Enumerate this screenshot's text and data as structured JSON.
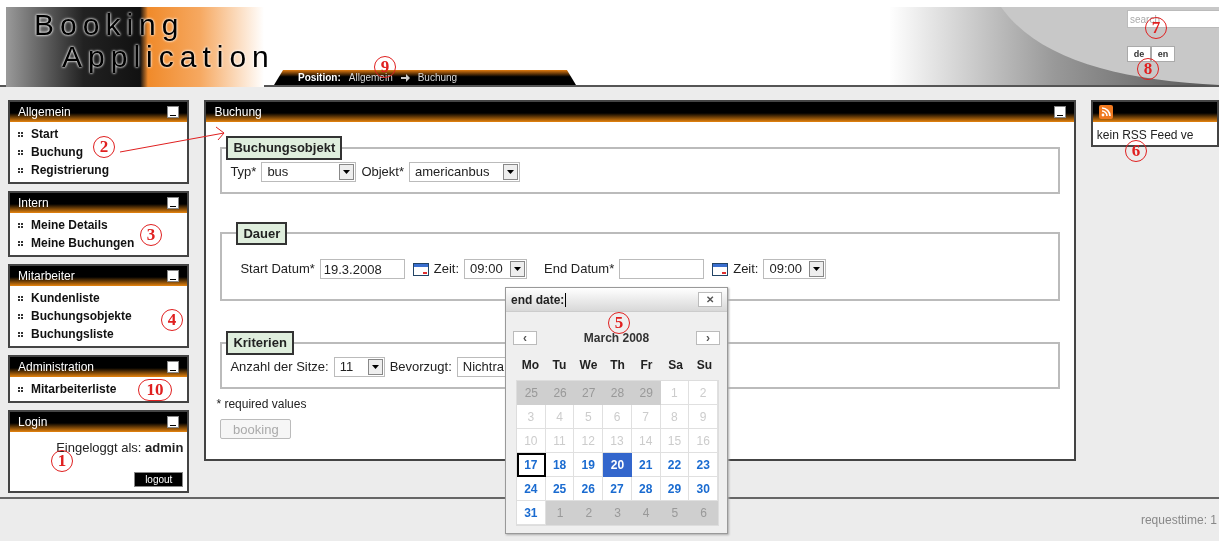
{
  "header": {
    "logo_lines": [
      "Booking",
      "Application"
    ],
    "breadcrumb": {
      "label": "Position:",
      "crumbs": [
        "Allgemein",
        "Buchung"
      ]
    },
    "search": {
      "placeholder": "search"
    },
    "languages": [
      "de",
      "en"
    ]
  },
  "sidebar": [
    {
      "title": "Allgemein",
      "items": [
        "Start",
        "Buchung",
        "Registrierung"
      ]
    },
    {
      "title": "Intern",
      "items": [
        "Meine Details",
        "Meine Buchungen"
      ]
    },
    {
      "title": "Mitarbeiter",
      "items": [
        "Kundenliste",
        "Buchungsobjekte",
        "Buchungsliste"
      ]
    },
    {
      "title": "Administration",
      "items": [
        "Mitarbeiterliste"
      ]
    }
  ],
  "login": {
    "title": "Login",
    "text": "Eingeloggt als: **admin**",
    "button": "logout"
  },
  "main": {
    "title": "Buchung",
    "fieldsets": [
      {
        "legend": "Buchungsobjekt",
        "fields": [
          {
            "label": "Typ*",
            "kind": "select",
            "value": "bus"
          },
          {
            "label": "Objekt*",
            "kind": "select",
            "value": "americanbus"
          }
        ]
      },
      {
        "legend": "Dauer",
        "fields": [
          {
            "label": "Start Datum*",
            "kind": "date",
            "value": "19.3.2008"
          },
          {
            "label": "Zeit:",
            "kind": "select",
            "value": "09:00"
          },
          {
            "label": "End Datum*",
            "kind": "date"
          },
          {
            "label": "Zeit:",
            "kind": "select",
            "value": "09:00"
          }
        ]
      },
      {
        "legend": "Kriterien",
        "fields": [
          {
            "label": "Anzahl der Sitze:",
            "kind": "select",
            "value": "11"
          },
          {
            "label": "Bevorzugt:",
            "kind": "select",
            "value": "Nichtra"
          }
        ]
      }
    ],
    "note": "* required values",
    "button": {
      "label": "booking",
      "disabled": true
    }
  },
  "calendar": {
    "field_label": "end date:",
    "close": "✕",
    "prev": "‹",
    "next": "›",
    "month": "March 2008",
    "weekdays": [
      "Mo",
      "Tu",
      "We",
      "Th",
      "Fr",
      "Sa",
      "Su"
    ],
    "days": [
      {
        "label": "25",
        "kind": "outside",
        "selected": false,
        "today": false
      },
      {
        "label": "26",
        "kind": "outside",
        "selected": false,
        "today": false
      },
      {
        "label": "27",
        "kind": "outside",
        "selected": false,
        "today": false
      },
      {
        "label": "28",
        "kind": "outside",
        "selected": false,
        "today": false
      },
      {
        "label": "29",
        "kind": "outside",
        "selected": false,
        "today": false
      },
      {
        "label": "1",
        "kind": "disabled",
        "selected": false,
        "today": false
      },
      {
        "label": "2",
        "kind": "disabled",
        "selected": false,
        "today": false
      },
      {
        "label": "3",
        "kind": "disabled",
        "selected": false,
        "today": false
      },
      {
        "label": "4",
        "kind": "disabled",
        "selected": false,
        "today": false
      },
      {
        "label": "5",
        "kind": "disabled",
        "selected": false,
        "today": false
      },
      {
        "label": "6",
        "kind": "disabled",
        "selected": false,
        "today": false
      },
      {
        "label": "7",
        "kind": "disabled",
        "selected": false,
        "today": false
      },
      {
        "label": "8",
        "kind": "disabled",
        "selected": false,
        "today": false
      },
      {
        "label": "9",
        "kind": "disabled",
        "selected": false,
        "today": false
      },
      {
        "label": "10",
        "kind": "disabled",
        "selected": false,
        "today": false
      },
      {
        "label": "11",
        "kind": "disabled",
        "selected": false,
        "today": false
      },
      {
        "label": "12",
        "kind": "disabled",
        "selected": false,
        "today": false
      },
      {
        "label": "13",
        "kind": "disabled",
        "selected": false,
        "today": false
      },
      {
        "label": "14",
        "kind": "disabled",
        "selected": false,
        "today": false
      },
      {
        "label": "15",
        "kind": "disabled",
        "selected": false,
        "today": false
      },
      {
        "label": "16",
        "kind": "disabled",
        "selected": false,
        "today": false
      },
      {
        "label": "17",
        "kind": "available",
        "selected": false,
        "today": true
      },
      {
        "label": "18",
        "kind": "available",
        "selected": false,
        "today": false
      },
      {
        "label": "19",
        "kind": "available",
        "selected": false,
        "today": false
      },
      {
        "label": "20",
        "kind": "available",
        "selected": true,
        "today": false
      },
      {
        "label": "21",
        "kind": "available",
        "selected": false,
        "today": false
      },
      {
        "label": "22",
        "kind": "available",
        "selected": false,
        "today": false
      },
      {
        "label": "23",
        "kind": "available",
        "selected": false,
        "today": false
      },
      {
        "label": "24",
        "kind": "available",
        "selected": false,
        "today": false
      },
      {
        "label": "25",
        "kind": "available",
        "selected": false,
        "today": false
      },
      {
        "label": "26",
        "kind": "available",
        "selected": false,
        "today": false
      },
      {
        "label": "27",
        "kind": "available",
        "selected": false,
        "today": false
      },
      {
        "label": "28",
        "kind": "available",
        "selected": false,
        "today": false
      },
      {
        "label": "29",
        "kind": "available",
        "selected": false,
        "today": false
      },
      {
        "label": "30",
        "kind": "available",
        "selected": false,
        "today": false
      },
      {
        "label": "31",
        "kind": "available",
        "selected": false,
        "today": false
      },
      {
        "label": "1",
        "kind": "outside",
        "selected": false,
        "today": false
      },
      {
        "label": "2",
        "kind": "outside",
        "selected": false,
        "today": false
      },
      {
        "label": "3",
        "kind": "outside",
        "selected": false,
        "today": false
      },
      {
        "label": "4",
        "kind": "outside",
        "selected": false,
        "today": false
      },
      {
        "label": "5",
        "kind": "outside",
        "selected": false,
        "today": false
      },
      {
        "label": "6",
        "kind": "outside",
        "selected": false,
        "today": false
      }
    ]
  },
  "rss": {
    "text": "kein RSS Feed ve"
  },
  "status_bar": {
    "text": "requesttime: 1"
  },
  "annotations": [
    {
      "label": "1"
    },
    {
      "label": "2"
    },
    {
      "label": "3"
    },
    {
      "label": "4"
    },
    {
      "label": "5"
    },
    {
      "label": "6"
    },
    {
      "label": "7"
    },
    {
      "label": "8"
    },
    {
      "label": "9"
    },
    {
      "label": "10"
    }
  ]
}
